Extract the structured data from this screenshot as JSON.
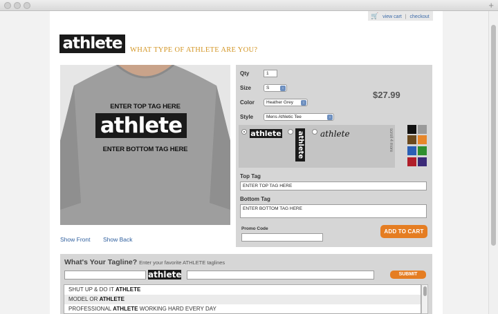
{
  "window": {
    "controls": [
      "close",
      "minimize",
      "zoom"
    ]
  },
  "header": {
    "cart_icon": "shopping-cart-icon",
    "view_cart": "view cart",
    "separator": "|",
    "checkout": "checkout",
    "logo_text": "athlete",
    "tagline": "WHAT TYPE OF ATHLETE ARE YOU?"
  },
  "preview": {
    "top_tag": "ENTER TOP TAG HERE",
    "logo_text": "athlete",
    "bottom_tag": "ENTER BOTTOM TAG HERE",
    "show_front": "Show Front",
    "show_back": "Show Back"
  },
  "options": {
    "qty_label": "Qty",
    "qty_value": "1",
    "size_label": "Size",
    "size_value": "S",
    "color_label": "Color",
    "color_value": "Heather Grey",
    "style_label": "Style",
    "style_value": "Mens Athletic Tee",
    "price": "$27.99",
    "logo_styles": [
      {
        "name": "horizontal",
        "text": "athlete",
        "selected": true
      },
      {
        "name": "vertical",
        "text": "athlete",
        "selected": false
      },
      {
        "name": "script",
        "text": "athlete",
        "selected": false
      }
    ],
    "scroll_more": "scroll 4 more",
    "swatches": [
      "#111111",
      "#9a9a9a",
      "#6b4a1e",
      "#e8872a",
      "#2a5fb5",
      "#2f8f2f",
      "#b01e2a",
      "#3b2a78"
    ],
    "top_tag_label": "Top Tag",
    "top_tag_value": "ENTER TOP TAG HERE",
    "bottom_tag_label": "Bottom Tag",
    "bottom_tag_value": "ENTER BOTTOM TAG HERE",
    "promo_label": "Promo Code",
    "promo_value": "",
    "add_to_cart": "ADD TO CART"
  },
  "tagline_section": {
    "title": "What's Your Tagline?",
    "subtitle": "Enter your favorite ATHLETE taglines",
    "logo_text": "athlete",
    "submit": "SUBMIT",
    "items": [
      {
        "pre": "SHUT UP & DO IT ",
        "bold": "ATHLETE",
        "post": ""
      },
      {
        "pre": "MODEL OR ",
        "bold": "ATHLETE",
        "post": ""
      },
      {
        "pre": "PROFESSIONAL ",
        "bold": "ATHLETE",
        "post": " WORKING HARD EVERY DAY"
      }
    ]
  },
  "colors": {
    "accent": "#e57d22",
    "link": "#2f5f9e",
    "tagline": "#d39523",
    "panel": "#d6d6d6"
  }
}
